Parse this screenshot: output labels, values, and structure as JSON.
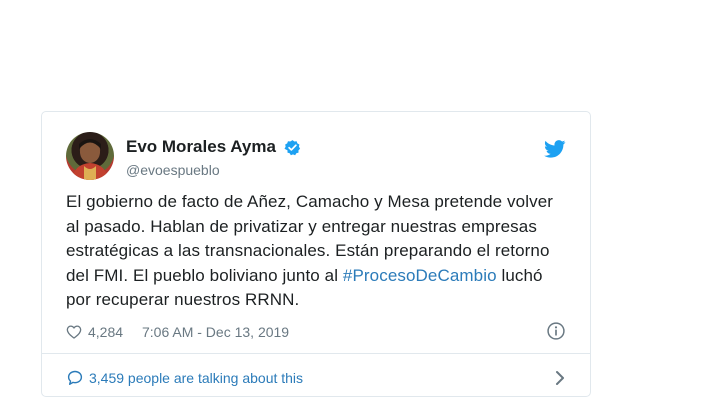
{
  "tweet": {
    "author_name": "Evo Morales Ayma",
    "handle": "@evoespueblo",
    "text_before": "El gobierno de facto de Añez, Camacho y Mesa pretende volver al pasado. Hablan de privatizar y entregar nuestras empresas estratégicas a las transnacionales. Están preparando el retorno del FMI. El pueblo boliviano junto al ",
    "hashtag": "#ProcesoDeCambio",
    "text_after": " luchó por recuperar nuestros RRNN.",
    "likes": "4,284",
    "timestamp": "7:06 AM - Dec 13, 2019",
    "talking": "3,459 people are talking about this"
  },
  "icons": {
    "verified": "verified-badge-icon",
    "brand": "twitter-bird-icon",
    "like": "heart-icon",
    "info": "info-icon",
    "reply": "speech-bubble-icon",
    "chevron": "chevron-right-icon"
  },
  "colors": {
    "link": "#2b7bb9",
    "brand": "#1da1f2",
    "muted": "#697882",
    "border": "#e1e8ed"
  }
}
